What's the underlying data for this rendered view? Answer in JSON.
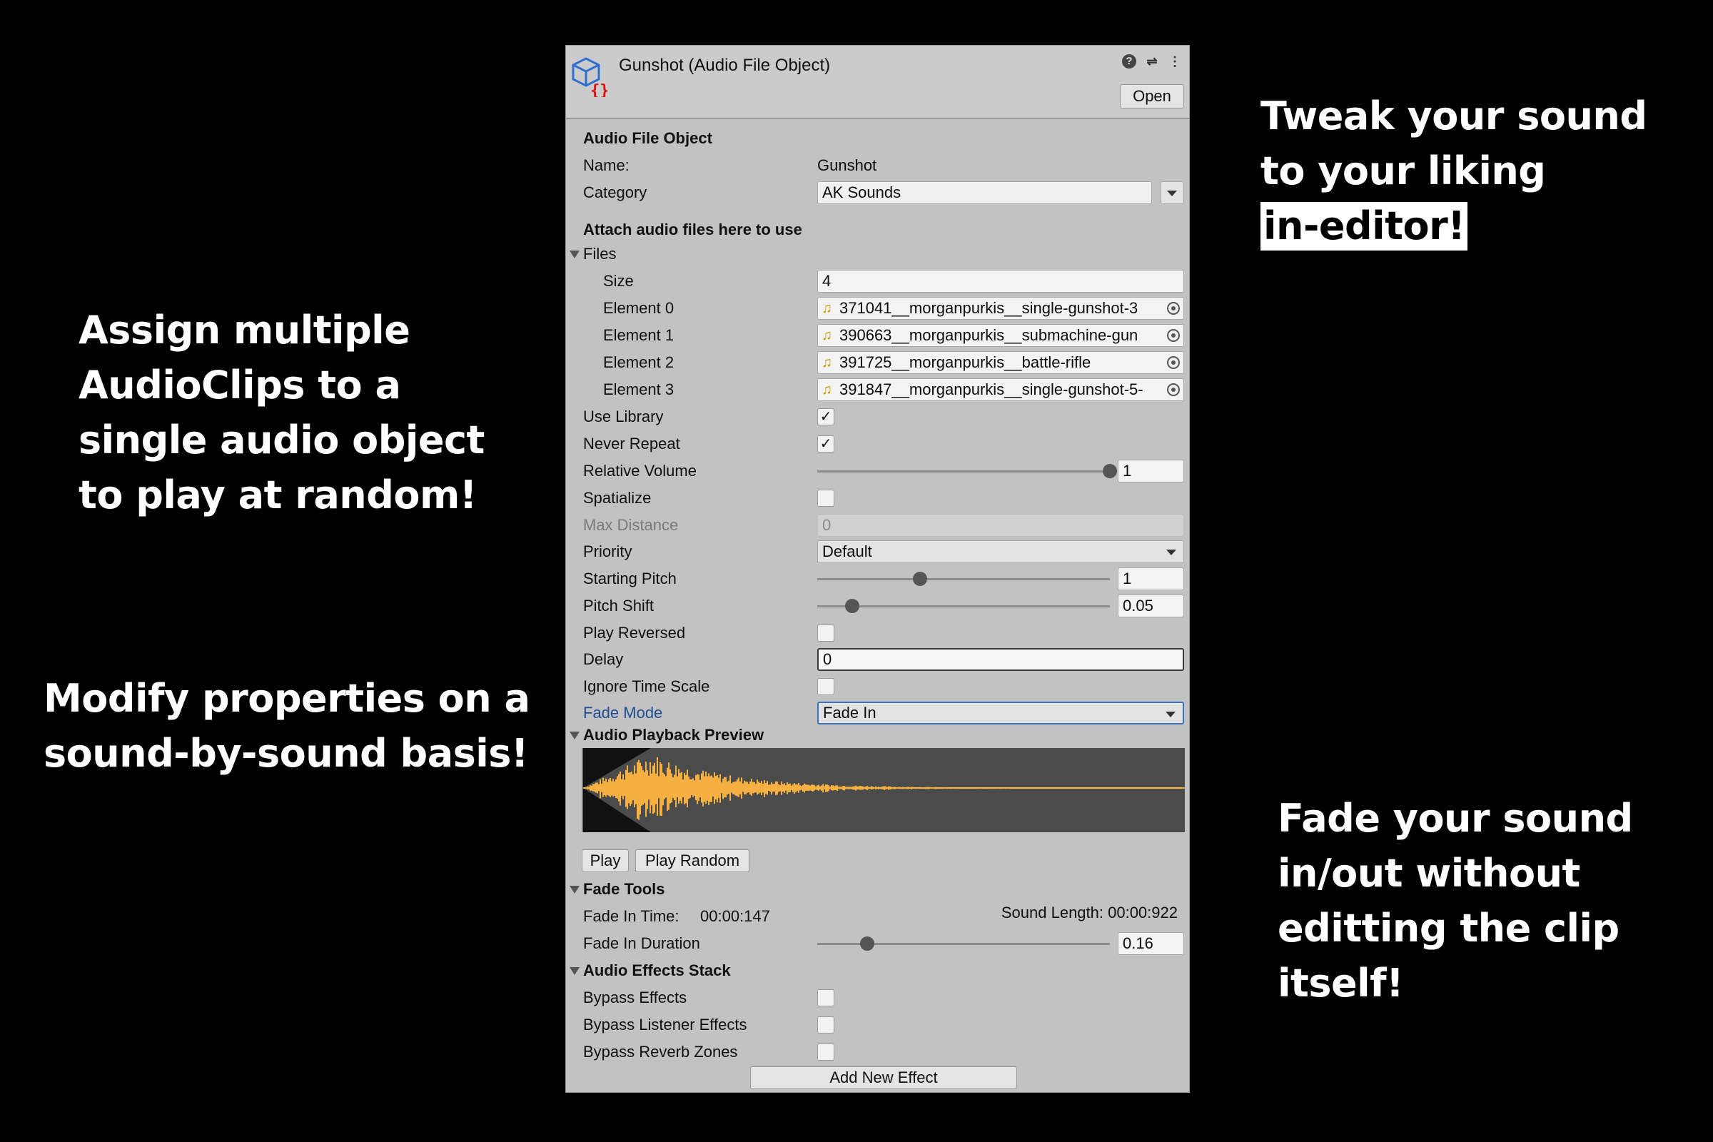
{
  "promo": {
    "right_top": {
      "line1": "Tweak your sound",
      "line2": "to your liking",
      "line3": "in-editor!"
    },
    "left_top": {
      "line1": "Assign multiple",
      "line2": "AudioClips to a",
      "line3": "single audio object",
      "line4": "to play at random!"
    },
    "left_bottom": {
      "line1": "Modify properties on a",
      "line2": "sound-by-sound basis!"
    },
    "right_bottom": {
      "line1": "Fade your sound",
      "line2": "in/out without",
      "line3": "editting the clip",
      "line4": "itself!"
    }
  },
  "header": {
    "title": "Gunshot (Audio File Object)",
    "open_label": "Open",
    "help_glyph": "?",
    "settings_glyph": "⇌",
    "menu_glyph": "⋮"
  },
  "section_audio_file_object": "Audio File Object",
  "name_label": "Name:",
  "name_value": "Gunshot",
  "category_label": "Category",
  "category_value": "AK Sounds",
  "attach_label": "Attach audio files here to use",
  "files": {
    "label": "Files",
    "size_label": "Size",
    "size_value": "4",
    "elements": [
      {
        "label": "Element 0",
        "value": "371041__morganpurkis__single-gunshot-3"
      },
      {
        "label": "Element 1",
        "value": "390663__morganpurkis__submachine-gun"
      },
      {
        "label": "Element 2",
        "value": "391725__morganpurkis__battle-rifle"
      },
      {
        "label": "Element 3",
        "value": "391847__morganpurkis__single-gunshot-5-"
      }
    ]
  },
  "props": {
    "use_library": {
      "label": "Use Library",
      "checked": "✓"
    },
    "never_repeat": {
      "label": "Never Repeat",
      "checked": "✓"
    },
    "relative_volume": {
      "label": "Relative Volume",
      "value": "1",
      "level": 1.0
    },
    "spatialize": {
      "label": "Spatialize"
    },
    "max_distance": {
      "label": "Max Distance",
      "value": "0"
    },
    "priority": {
      "label": "Priority",
      "value": "Default"
    },
    "starting_pitch": {
      "label": "Starting Pitch",
      "value": "1",
      "level": 0.35
    },
    "pitch_shift": {
      "label": "Pitch Shift",
      "value": "0.05",
      "level": 0.12
    },
    "play_reversed": {
      "label": "Play Reversed"
    },
    "delay": {
      "label": "Delay",
      "value": "0"
    },
    "ignore_time_scale": {
      "label": "Ignore Time Scale"
    },
    "fade_mode": {
      "label": "Fade Mode",
      "value": "Fade In"
    }
  },
  "preview": {
    "label": "Audio Playback Preview",
    "play_label": "Play",
    "play_random_label": "Play Random",
    "wave_color": "#f5b041"
  },
  "fade_tools": {
    "label": "Fade Tools",
    "fade_in_time_label": "Fade In Time:",
    "fade_in_time_value": "00:00:147",
    "sound_length": "Sound Length: 00:00:922",
    "fade_in_duration_label": "Fade In Duration",
    "fade_in_duration_value": "0.16",
    "level": 0.17
  },
  "effects": {
    "label": "Audio Effects Stack",
    "bypass_effects": "Bypass Effects",
    "bypass_listener": "Bypass Listener Effects",
    "bypass_reverb": "Bypass Reverb Zones",
    "add_label": "Add New Effect"
  }
}
